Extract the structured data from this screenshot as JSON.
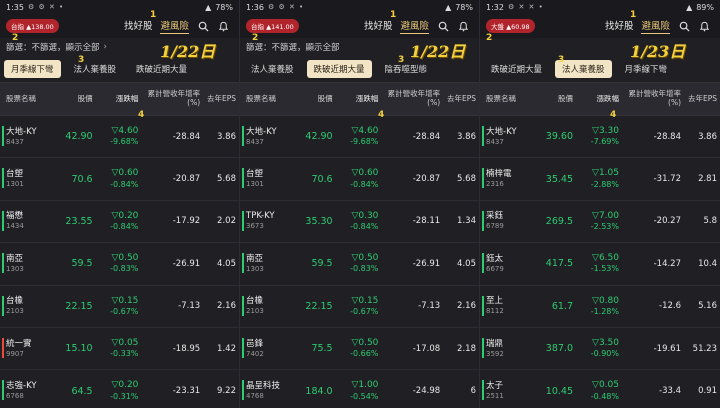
{
  "panels": [
    {
      "time": "1:35",
      "battery": "78%",
      "status_icons": "⚙ ⚙ ✕ •",
      "index_badge": "台指 ▲138.00",
      "tabs": [
        "找好股",
        "避風險"
      ],
      "filter_text": "篩選：不篩選，顯示全部",
      "date_overlay": "1/22日",
      "categories": [
        {
          "label": "月季線下彎",
          "selected": true
        },
        {
          "label": "法人棄養股",
          "selected": false
        },
        {
          "label": "跌破近期大量",
          "selected": false
        }
      ],
      "columns": [
        "股票名稱",
        "股價",
        "漲跌幅",
        "累計營收年增率(%)",
        "去年EPS"
      ],
      "rows": [
        {
          "name": "大地-KY",
          "code": "8437",
          "price": "42.90",
          "change": "▽4.60",
          "pct": "-9.68%",
          "rev": "-28.84",
          "eps": "3.86",
          "bar": "green"
        },
        {
          "name": "台塑",
          "code": "1301",
          "price": "70.6",
          "change": "▽0.60",
          "pct": "-0.84%",
          "rev": "-20.87",
          "eps": "5.68",
          "bar": "green"
        },
        {
          "name": "福懋",
          "code": "1434",
          "price": "23.55",
          "change": "▽0.20",
          "pct": "-0.84%",
          "rev": "-17.92",
          "eps": "2.02",
          "bar": "green"
        },
        {
          "name": "南亞",
          "code": "1303",
          "price": "59.5",
          "change": "▽0.50",
          "pct": "-0.83%",
          "rev": "-26.91",
          "eps": "4.05",
          "bar": "green"
        },
        {
          "name": "台橡",
          "code": "2103",
          "price": "22.15",
          "change": "▽0.15",
          "pct": "-0.67%",
          "rev": "-7.13",
          "eps": "2.16",
          "bar": "green"
        },
        {
          "name": "統一實",
          "code": "9907",
          "price": "15.10",
          "change": "▽0.05",
          "pct": "-0.33%",
          "rev": "-18.95",
          "eps": "1.42",
          "bar": "red"
        },
        {
          "name": "志強-KY",
          "code": "6768",
          "price": "64.5",
          "change": "▽0.20",
          "pct": "-0.31%",
          "rev": "-23.31",
          "eps": "9.22",
          "bar": "green"
        }
      ]
    },
    {
      "time": "1:36",
      "battery": "78%",
      "status_icons": "⚙ ⚙ ✕ •",
      "index_badge": "台指 ▲141.00",
      "tabs": [
        "找好股",
        "避風險"
      ],
      "filter_text": "篩選：不篩選，顯示全部",
      "date_overlay": "1/22日",
      "categories": [
        {
          "label": "法人棄養股",
          "selected": false
        },
        {
          "label": "跌破近期大量",
          "selected": true
        },
        {
          "label": "陰吞噬型態",
          "selected": false
        }
      ],
      "columns": [
        "股票名稱",
        "股價",
        "漲跌幅",
        "累計營收年增率(%)",
        "去年EPS"
      ],
      "rows": [
        {
          "name": "大地-KY",
          "code": "8437",
          "price": "42.90",
          "change": "▽4.60",
          "pct": "-9.68%",
          "rev": "-28.84",
          "eps": "3.86",
          "bar": "green"
        },
        {
          "name": "台塑",
          "code": "1301",
          "price": "70.6",
          "change": "▽0.60",
          "pct": "-0.84%",
          "rev": "-20.87",
          "eps": "5.68",
          "bar": "green"
        },
        {
          "name": "TPK-KY",
          "code": "3673",
          "price": "35.30",
          "change": "▽0.30",
          "pct": "-0.84%",
          "rev": "-28.11",
          "eps": "1.34",
          "bar": "green"
        },
        {
          "name": "南亞",
          "code": "1303",
          "price": "59.5",
          "change": "▽0.50",
          "pct": "-0.83%",
          "rev": "-26.91",
          "eps": "4.05",
          "bar": "green"
        },
        {
          "name": "台橡",
          "code": "2103",
          "price": "22.15",
          "change": "▽0.15",
          "pct": "-0.67%",
          "rev": "-7.13",
          "eps": "2.16",
          "bar": "green"
        },
        {
          "name": "邑鋒",
          "code": "7402",
          "price": "75.5",
          "change": "▽0.50",
          "pct": "-0.66%",
          "rev": "-17.08",
          "eps": "2.18",
          "bar": "green"
        },
        {
          "name": "晶呈科技",
          "code": "4768",
          "price": "184.0",
          "change": "▽1.00",
          "pct": "-0.54%",
          "rev": "-24.98",
          "eps": "6",
          "bar": "green"
        }
      ]
    },
    {
      "time": "1:32",
      "battery": "89%",
      "status_icons": "⚙ ✕ ✕ •",
      "index_badge": "大盤 ▲60.98",
      "tabs": [
        "找好股",
        "避風險"
      ],
      "filter_text": "",
      "date_overlay": "1/23日",
      "categories": [
        {
          "label": "跌破近期大量",
          "selected": false
        },
        {
          "label": "法人棄養股",
          "selected": true
        },
        {
          "label": "月季線下彎",
          "selected": false
        }
      ],
      "columns": [
        "股票名稱",
        "股價",
        "漲跌幅",
        "累計營收年增率(%)",
        "去年EPS"
      ],
      "rows": [
        {
          "name": "大地-KY",
          "code": "8437",
          "price": "39.60",
          "change": "▽3.30",
          "pct": "-7.69%",
          "rev": "-28.84",
          "eps": "3.86",
          "bar": "green"
        },
        {
          "name": "楠梓電",
          "code": "2316",
          "price": "35.45",
          "change": "▽1.05",
          "pct": "-2.88%",
          "rev": "-31.72",
          "eps": "2.81",
          "bar": "green"
        },
        {
          "name": "采鈺",
          "code": "6789",
          "price": "269.5",
          "change": "▽7.00",
          "pct": "-2.53%",
          "rev": "-20.27",
          "eps": "5.8",
          "bar": "green"
        },
        {
          "name": "鈺太",
          "code": "6679",
          "price": "417.5",
          "change": "▽6.50",
          "pct": "-1.53%",
          "rev": "-14.27",
          "eps": "10.4",
          "bar": "green"
        },
        {
          "name": "至上",
          "code": "8112",
          "price": "61.7",
          "change": "▽0.80",
          "pct": "-1.28%",
          "rev": "-12.6",
          "eps": "5.16",
          "bar": "green"
        },
        {
          "name": "瑞鼎",
          "code": "3592",
          "price": "387.0",
          "change": "▽3.50",
          "pct": "-0.90%",
          "rev": "-19.61",
          "eps": "51.23",
          "bar": "green"
        },
        {
          "name": "太子",
          "code": "2511",
          "price": "10.45",
          "change": "▽0.05",
          "pct": "-0.48%",
          "rev": "-33.4",
          "eps": "0.91",
          "bar": "green"
        }
      ]
    }
  ],
  "markers": [
    "1",
    "2",
    "3",
    "4"
  ]
}
